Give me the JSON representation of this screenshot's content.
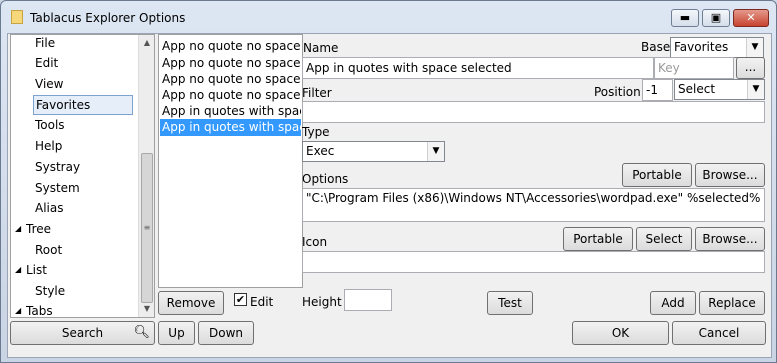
{
  "window": {
    "title": "Tablacus Explorer Options",
    "min_glyph": "▬",
    "max_glyph": "▣",
    "close_glyph": "✕"
  },
  "tree": {
    "items": [
      {
        "label": "File"
      },
      {
        "label": "Edit"
      },
      {
        "label": "View"
      },
      {
        "label": "Favorites"
      },
      {
        "label": "Tools"
      },
      {
        "label": "Help"
      },
      {
        "label": "Systray"
      },
      {
        "label": "System"
      },
      {
        "label": "Alias"
      },
      {
        "label": "Tree"
      },
      {
        "label": "Root"
      },
      {
        "label": "List"
      },
      {
        "label": "Style"
      },
      {
        "label": "Tabs"
      }
    ],
    "selected": "Favorites"
  },
  "list": {
    "items": [
      "App no quote no space no selected",
      "App no quote no space no selected",
      "App no quote no space selected",
      "App no quote no space selected",
      "App in quotes with space",
      "App in quotes with space selected"
    ],
    "selected_index": 5
  },
  "form": {
    "name_label": "Name",
    "name_value": "App in quotes with space selected",
    "base_label": "Base",
    "base_value": "Favorites",
    "key_placeholder": "Key",
    "key_browse": "...",
    "filter_label": "Filter",
    "filter_value": "",
    "position_label": "Position",
    "position_value": "-1",
    "position_select": "Select",
    "type_label": "Type",
    "type_value": "Exec",
    "options_label": "Options",
    "options_value": "\"C:\\Program Files (x86)\\Windows NT\\Accessories\\wordpad.exe\" %selected%",
    "portable_label": "Portable",
    "browse_label": "Browse...",
    "icon_label": "Icon",
    "icon_portable_label": "Portable",
    "icon_select_label": "Select",
    "icon_browse_label": "Browse...",
    "icon_value": "",
    "height_label": "Height",
    "height_value": ""
  },
  "bottom": {
    "remove_label": "Remove",
    "edit_label": "Edit",
    "edit_checked": true,
    "test_label": "Test",
    "add_label": "Add",
    "replace_label": "Replace",
    "search_label": "Search",
    "up_label": "Up",
    "down_label": "Down",
    "ok_label": "OK",
    "cancel_label": "Cancel"
  }
}
